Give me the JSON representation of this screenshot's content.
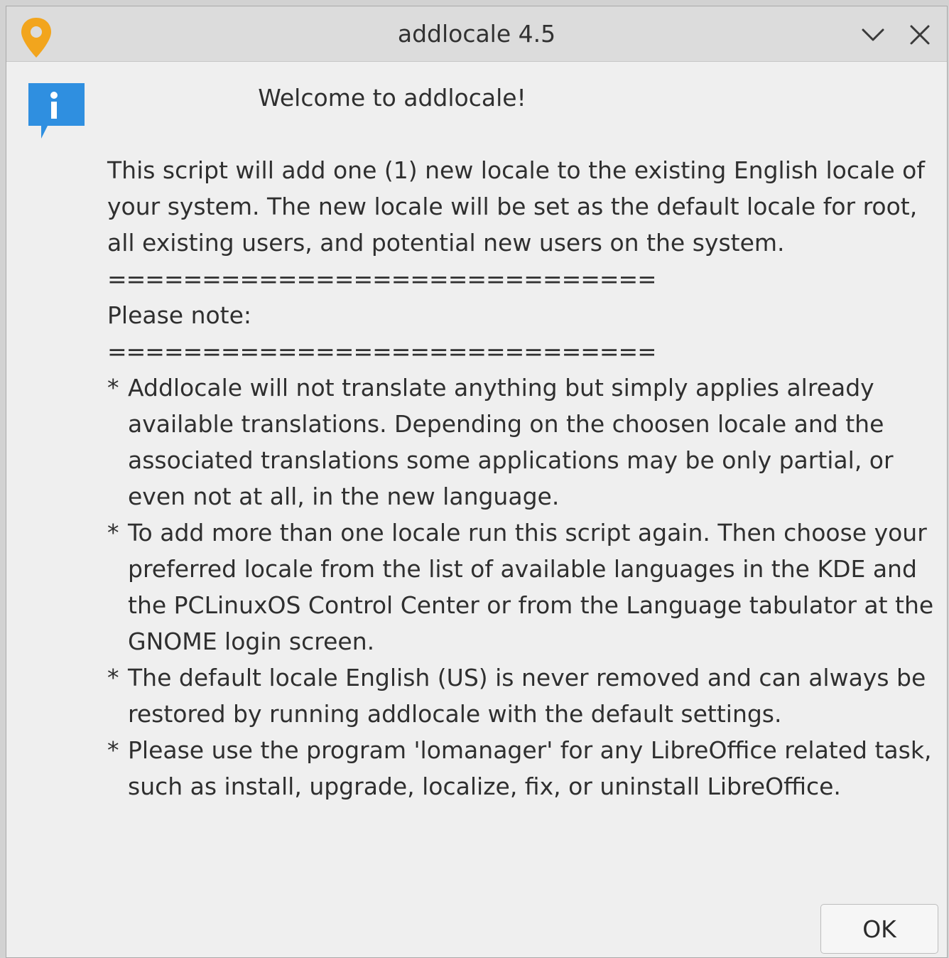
{
  "window": {
    "title": "addlocale 4.5",
    "accent_color": "#f2a51d",
    "info_icon_color": "#2f8fe0"
  },
  "titlebar": {
    "app_icon": "map-pin-icon",
    "minimize_icon": "chevron-down-icon",
    "close_icon": "close-icon"
  },
  "dialog": {
    "icon": "info-icon",
    "heading": "Welcome to addlocale!",
    "intro": "This script will add one (1) new locale to the existing English locale of your system. The new locale will be set as the default locale for root, all existing users, and potential new users on the system.",
    "separator": "============================================",
    "note_label": "Please note:",
    "bullet_mark": "*",
    "bullets": [
      "Addlocale will not translate anything but simply applies already available translations. Depending on the choosen locale and the associated translations some applications may be only partial, or even not at all, in the new language.",
      "To add more than one locale run this script again. Then choose your preferred locale from the list of available languages in the KDE and the PCLinuxOS Control Center or from the Language tabulator at the GNOME login screen.",
      "The default locale English (US) is never removed and can always be restored by running addlocale with the default settings.",
      "Please use the program 'lomanager' for any LibreOffice related task, such as install, upgrade, localize, fix, or uninstall LibreOffice."
    ],
    "ok_label": "OK"
  }
}
